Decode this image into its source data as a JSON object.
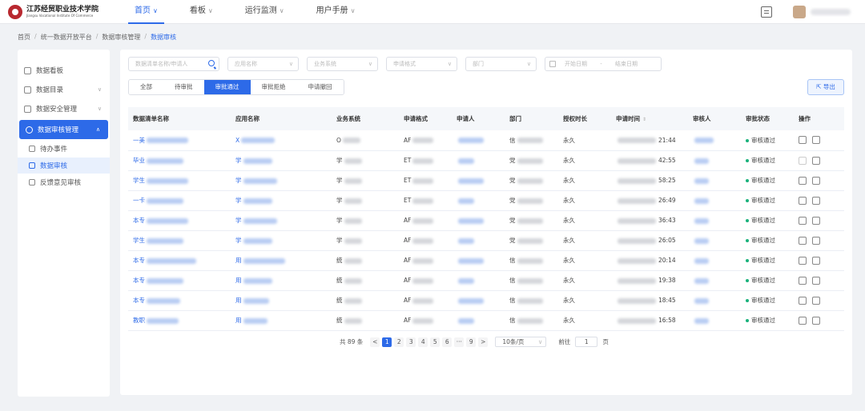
{
  "logo": {
    "cn": "江苏经贸职业技术学院",
    "en": "Jiangsu Vocational Institute Of Commerce"
  },
  "nav": [
    {
      "label": "首页",
      "active": true
    },
    {
      "label": "看板"
    },
    {
      "label": "运行监测"
    },
    {
      "label": "用户手册"
    }
  ],
  "breadcrumb": [
    "首页",
    "统一数据开放平台",
    "数据审核管理",
    "数据审核"
  ],
  "sidebar": {
    "items": [
      {
        "label": "数据看板"
      },
      {
        "label": "数据目录"
      },
      {
        "label": "数据安全管理"
      },
      {
        "label": "数据审核管理"
      }
    ],
    "sub": [
      {
        "label": "待办事件"
      },
      {
        "label": "数据审核"
      },
      {
        "label": "反馈意见审核"
      }
    ]
  },
  "filters": {
    "search": "数据清单名称/申请人",
    "app": "应用名称",
    "system": "业务系统",
    "format": "申请格式",
    "dept": "部门",
    "start": "开始日期",
    "dash": "-",
    "end": "结束日期"
  },
  "tabs": [
    "全部",
    "待审批",
    "审批通过",
    "审批拒绝",
    "申请撤回"
  ],
  "export_label": "导出",
  "table": {
    "headers": [
      "数据清单名称",
      "应用名称",
      "业务系统",
      "申请格式",
      "申请人",
      "部门",
      "授权时长",
      "申请时间",
      "审核人",
      "审批状态",
      "操作"
    ],
    "rows": [
      {
        "name": "一美",
        "app": "X",
        "sys": "O",
        "fmt": "AF",
        "dept": "信",
        "dur": "永久",
        "time": "21:44",
        "status": "审核通过"
      },
      {
        "name": "毕业",
        "app": "学",
        "sys": "学",
        "fmt": "ET",
        "dept": "党",
        "dur": "永久",
        "time": "42:55",
        "status": "审核通过"
      },
      {
        "name": "学生",
        "app": "学",
        "sys": "学",
        "fmt": "ET",
        "dept": "党",
        "dur": "永久",
        "time": "58:25",
        "status": "审核通过"
      },
      {
        "name": "一卡",
        "app": "学",
        "sys": "学",
        "fmt": "ET",
        "dept": "党",
        "dur": "永久",
        "time": "26:49",
        "status": "审核通过"
      },
      {
        "name": "本专",
        "app": "学",
        "sys": "学",
        "fmt": "AF",
        "dept": "党",
        "dur": "永久",
        "time": "36:43",
        "status": "审核通过"
      },
      {
        "name": "学生",
        "app": "学",
        "sys": "学",
        "fmt": "AF",
        "dept": "党",
        "dur": "永久",
        "time": "26:05",
        "status": "审核通过"
      },
      {
        "name": "本专",
        "app": "用",
        "sys": "统",
        "fmt": "AF",
        "dept": "信",
        "dur": "永久",
        "time": "20:14",
        "status": "审核通过"
      },
      {
        "name": "本专",
        "app": "用",
        "sys": "统",
        "fmt": "AF",
        "dept": "信",
        "dur": "永久",
        "time": "19:38",
        "status": "审核通过"
      },
      {
        "name": "本专",
        "app": "用",
        "sys": "统",
        "fmt": "AF",
        "dept": "信",
        "dur": "永久",
        "time": "18:45",
        "status": "审核通过"
      },
      {
        "name": "教职",
        "app": "用",
        "sys": "统",
        "fmt": "AF",
        "dept": "信",
        "dur": "永久",
        "time": "16:58",
        "status": "审核通过"
      }
    ]
  },
  "pagination": {
    "total": "共 89 条",
    "pages": [
      "1",
      "2",
      "3",
      "4",
      "5",
      "6",
      "···",
      "9"
    ],
    "prev": "<",
    "next": ">",
    "size": "10条/页",
    "goto": "前往",
    "page_value": "1",
    "page_unit": "页"
  }
}
